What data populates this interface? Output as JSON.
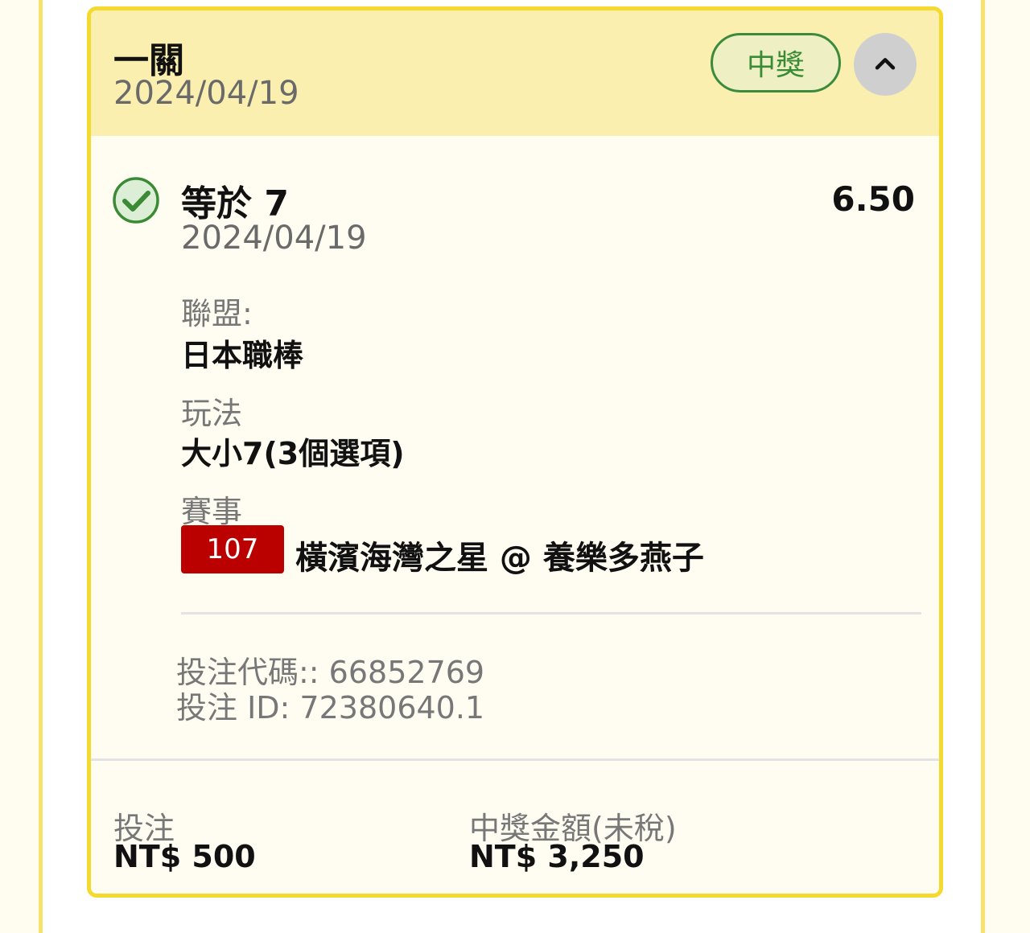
{
  "header": {
    "title": "一關",
    "date": "2024/04/19",
    "status": "中獎"
  },
  "selection": {
    "title": "等於 7",
    "date": "2024/04/19",
    "odds": "6.50"
  },
  "league": {
    "label": "聯盟:",
    "value": "日本職棒"
  },
  "market": {
    "label": "玩法",
    "value": "大小7(3個選項)"
  },
  "event": {
    "label": "賽事",
    "number": "107",
    "name": "橫濱海灣之星 @ 養樂多燕子"
  },
  "bet_code": {
    "line1": "投注代碼:: 66852769",
    "line2": "投注 ID: 72380640.1"
  },
  "footer": {
    "stake_label": "投注",
    "stake_value": "NT$ 500",
    "payout_label": "中獎金額(未稅)",
    "payout_value": "NT$ 3,250"
  },
  "colors": {
    "card_border": "#f6d92e",
    "header_bg": "#fbefb0",
    "win_green": "#3a8a36",
    "event_red": "#bb0000"
  },
  "icons": {
    "collapse": "chevron-up-icon",
    "selection": "check-circle-icon"
  }
}
